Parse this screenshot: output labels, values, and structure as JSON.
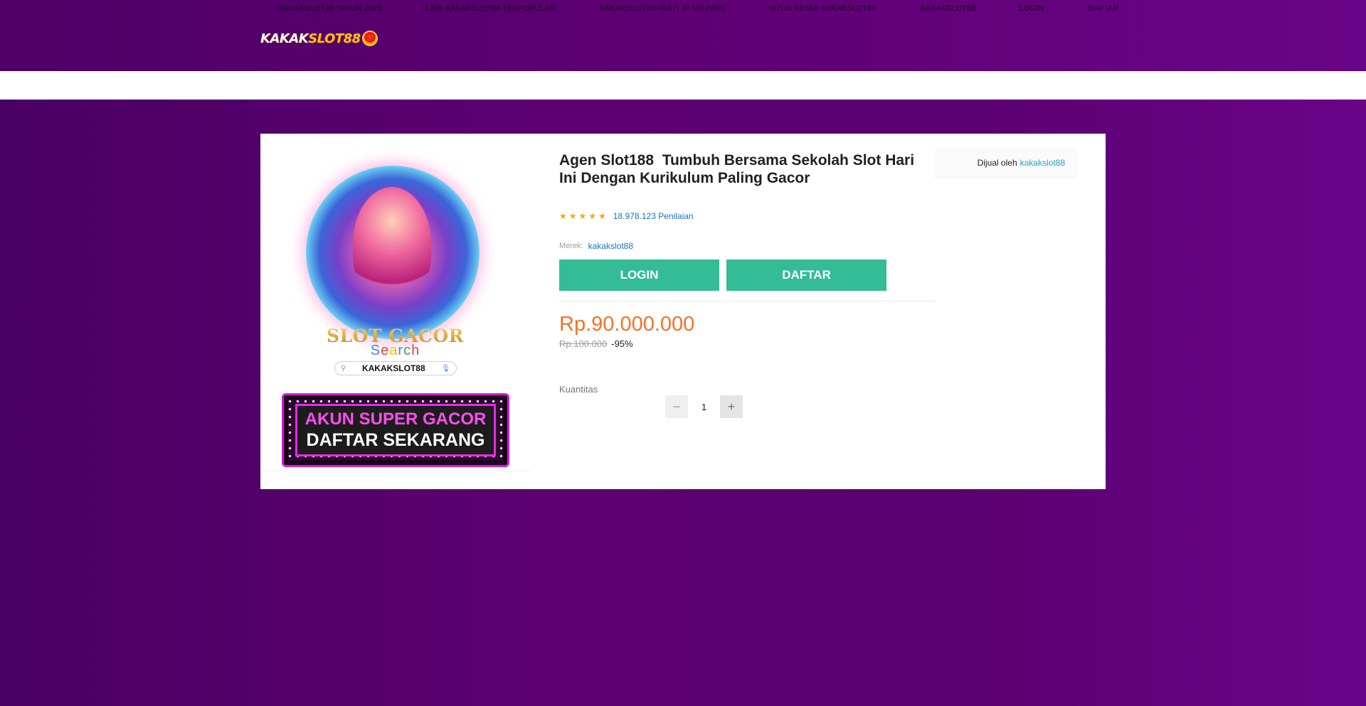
{
  "nav": {
    "items": [
      "KAKAKSLOT88 TAHUN 2025",
      "LINK KAKAKSLOT88 TERPOPULER",
      "KAKAKSLOT88 PASTI JP MAXWIN",
      "SITUS RESMI KAKAKSLOT88",
      "KAKAKSLOT88",
      "LOGIN",
      "DAFTAR"
    ]
  },
  "logo": {
    "part1": "KAKAK",
    "part2": "SLOT88"
  },
  "gallery": {
    "slot_title": "SLOT GACOR",
    "search_word": [
      "S",
      "e",
      "a",
      "r",
      "c",
      "h"
    ],
    "search_text": "KAKAKSLOT88",
    "banner_line1": "AKUN SUPER GACOR",
    "banner_line2": "DAFTAR SEKARANG"
  },
  "product": {
    "title": "Agen Slot188 ⁦ Tumbuh Bersama Sekolah Slot Hari Ini Dengan Kurikulum Paling Gacor",
    "rating_stars": 5,
    "rating_count": "18.978.123 Penilaian",
    "brand_label": "Merek:",
    "brand_value": "kakakslot88",
    "login_label": "LOGIN",
    "daftar_label": "DAFTAR",
    "price": "Rp.90.000.000",
    "original_price": "Rp.100.000",
    "discount": "-95%",
    "quantity_label": "Kuantitas",
    "quantity": "1"
  },
  "seller": {
    "prefix": "Dijual oleh",
    "name": "kakakslot88"
  },
  "colors": {
    "accent_green": "#34bc97",
    "price_orange": "#f57224",
    "link_blue": "#1a73c2",
    "bg_purple": "#5c0072"
  }
}
